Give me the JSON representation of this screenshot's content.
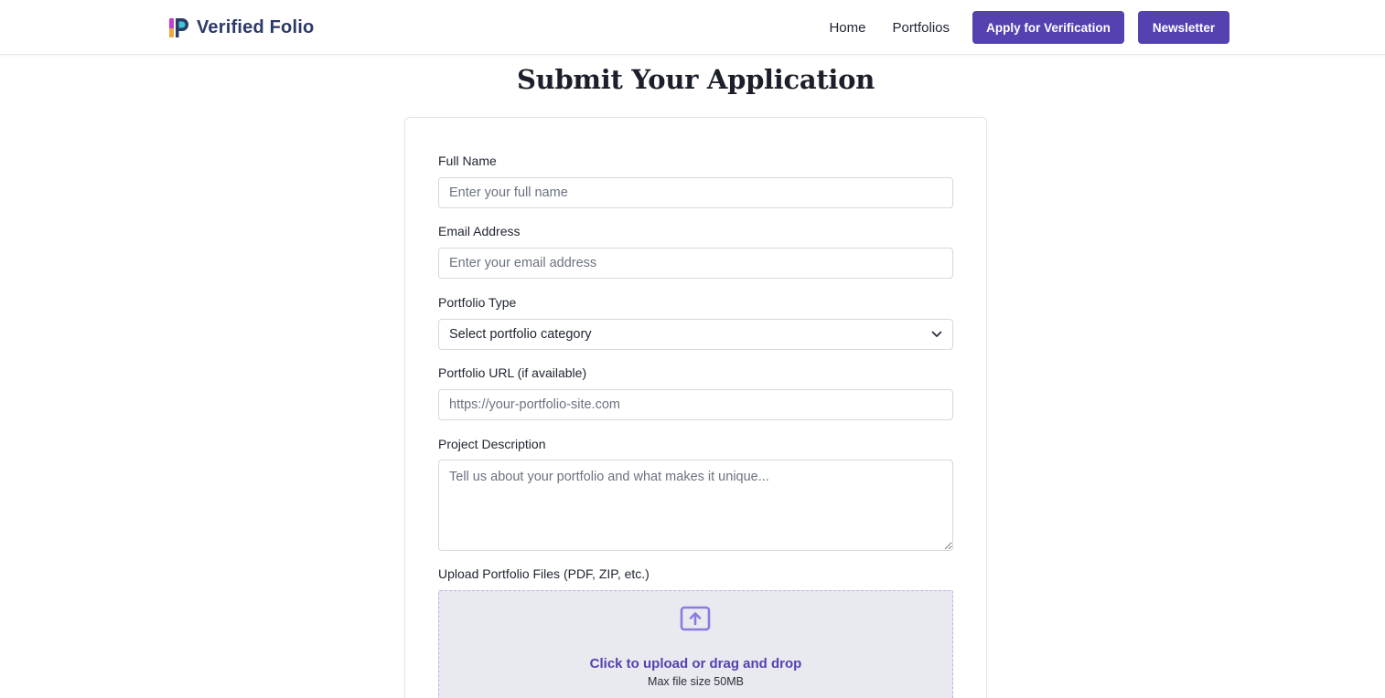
{
  "brand": {
    "name": "Verified Folio"
  },
  "nav": {
    "links": [
      "Home",
      "Portfolios"
    ],
    "apply_button": "Apply for Verification",
    "newsletter_button": "Newsletter"
  },
  "page": {
    "title": "Submit Your Application"
  },
  "form": {
    "full_name": {
      "label": "Full Name",
      "placeholder": "Enter your full name"
    },
    "email": {
      "label": "Email Address",
      "placeholder": "Enter your email address"
    },
    "portfolio_type": {
      "label": "Portfolio Type",
      "selected": "Select portfolio category"
    },
    "portfolio_url": {
      "label": "Portfolio URL (if available)",
      "placeholder": "https://your-portfolio-site.com"
    },
    "description": {
      "label": "Project Description",
      "placeholder": "Tell us about your portfolio and what makes it unique..."
    },
    "upload": {
      "label": "Upload Portfolio Files (PDF, ZIP, etc.)",
      "title": "Click to upload or drag and drop",
      "subtitle": "Max file size 50MB"
    }
  },
  "colors": {
    "accent": "#5541b0",
    "brand_text": "#2b3a67",
    "upload_bg": "#e8eaef"
  },
  "icons": {
    "logo": "verified-folio-logo-icon",
    "select": "chevron-down-icon",
    "upload": "upload-icon"
  }
}
